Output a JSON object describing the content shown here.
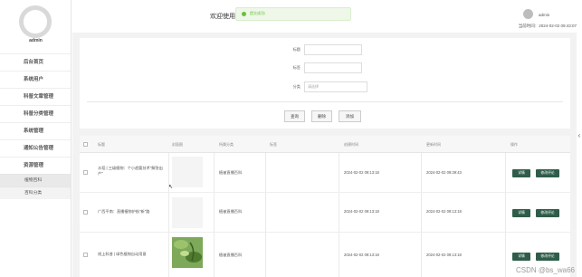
{
  "sidebar": {
    "user": "admin",
    "items": [
      {
        "label": "后台首页"
      },
      {
        "label": "系统用户"
      },
      {
        "label": "科普文章管理"
      },
      {
        "label": "科普分类管理"
      },
      {
        "label": "系统管理"
      },
      {
        "label": "通知公告管理"
      },
      {
        "label": "资源管理"
      }
    ],
    "subitems": [
      {
        "label": "植物百科",
        "active": true
      },
      {
        "label": "百科分类",
        "active": false
      }
    ]
  },
  "header": {
    "title": "欢迎使用",
    "toast": "提交成功!",
    "user": "admin",
    "time": "当前时间：2024-02-02 09:43:07"
  },
  "search": {
    "fields": [
      {
        "label": "标题",
        "placeholder": ""
      },
      {
        "label": "标签",
        "placeholder": ""
      },
      {
        "label": "分类",
        "placeholder": "请选择"
      }
    ],
    "buttons": {
      "query": "查询",
      "delete": "删除",
      "add": "添加"
    }
  },
  "table": {
    "columns": [
      "标题",
      "封面图",
      "所属分类",
      "标签",
      "创建时间",
      "更新时间",
      "操作"
    ],
    "rows": [
      {
        "title": "水稻 | 三级植物：个小趋要技术\"解答出产\"",
        "category": "植被直播百科",
        "tag": "",
        "created": "2024-02-02 09:13:18",
        "updated": "2024-02-02 09:39:43",
        "has_image": false
      },
      {
        "title": "广西平南：直播植物护航\"新\"路",
        "category": "植被直播百科",
        "tag": "",
        "created": "2024-02-02 09:13:18",
        "updated": "2024-02-02 09:13:18",
        "has_image": false
      },
      {
        "title": "线上科普 | 绿色植物自动用意",
        "category": "植被直播百科",
        "tag": "",
        "created": "2024-02-02 09:13:18",
        "updated": "2024-02-02 09:13:18",
        "has_image": true
      }
    ],
    "action_labels": {
      "detail": "详情",
      "edit": "修改评论"
    }
  },
  "watermark": "CSDN @bs_wa66",
  "colors": {
    "primary": "#2f5d4a",
    "toast": "#67c23a"
  }
}
